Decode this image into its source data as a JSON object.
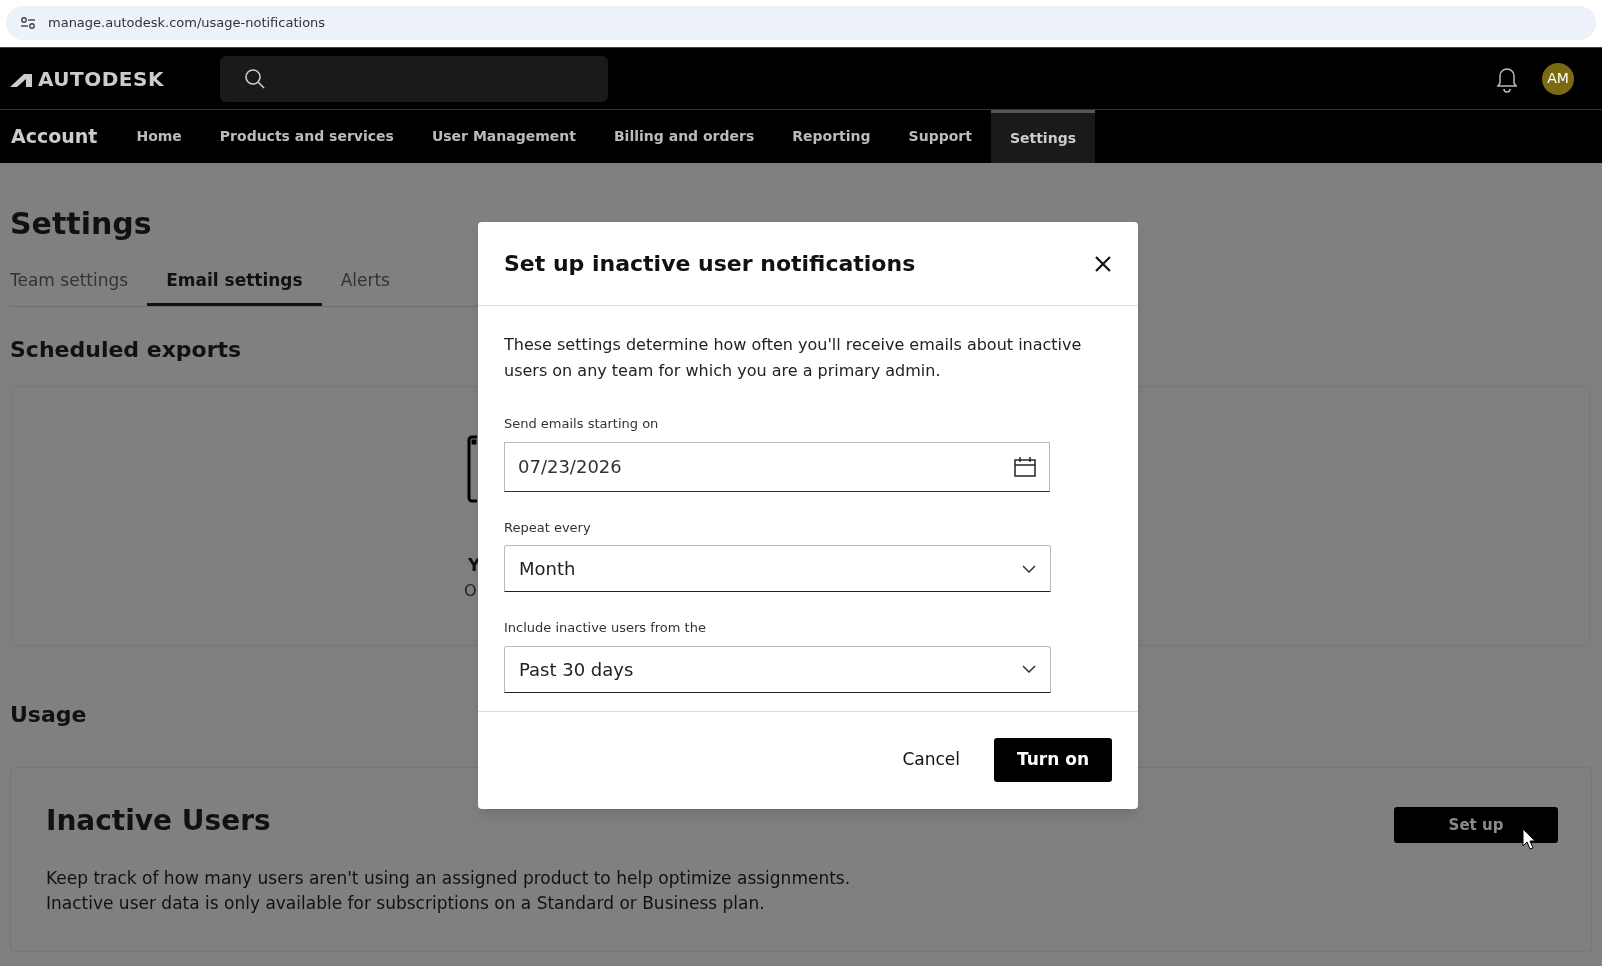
{
  "browser": {
    "url": "manage.autodesk.com/usage-notifications"
  },
  "header": {
    "logo": "AUTODESK",
    "avatar": "AM"
  },
  "nav": {
    "title": "Account",
    "items": [
      {
        "label": "Home",
        "selected": false
      },
      {
        "label": "Products and services",
        "selected": false
      },
      {
        "label": "User Management",
        "selected": false
      },
      {
        "label": "Billing and orders",
        "selected": false
      },
      {
        "label": "Reporting",
        "selected": false
      },
      {
        "label": "Support",
        "selected": false
      },
      {
        "label": "Settings",
        "selected": true
      }
    ]
  },
  "page": {
    "title": "Settings",
    "tabs": [
      {
        "label": "Team settings",
        "selected": false
      },
      {
        "label": "Email settings",
        "selected": true
      },
      {
        "label": "Alerts",
        "selected": false
      }
    ],
    "scheduled_exports": {
      "heading": "Scheduled exports",
      "empty_title": "Y",
      "empty_text": "O"
    },
    "usage": {
      "heading": "Usage",
      "card": {
        "title": "Inactive Users",
        "lines": [
          "Keep track of how many users aren't using an assigned product to help optimize assignments.",
          "Inactive user data is only available for subscriptions on a Standard or Business plan."
        ],
        "button": "Set up"
      }
    }
  },
  "dialog": {
    "title": "Set up inactive user notifications",
    "description": "These settings determine how often you'll receive emails about inactive users on any team for which you are a primary admin.",
    "fields": [
      {
        "kind": "date",
        "label": "Send emails starting on",
        "value": "07/23/2026"
      },
      {
        "kind": "select",
        "label": "Repeat every",
        "value": "Month"
      },
      {
        "kind": "select",
        "label": "Include inactive users from the",
        "value": "Past 30 days"
      }
    ],
    "buttons": [
      {
        "kind": "secondary",
        "label": "Cancel"
      },
      {
        "kind": "primary",
        "label": "Turn on"
      }
    ]
  }
}
